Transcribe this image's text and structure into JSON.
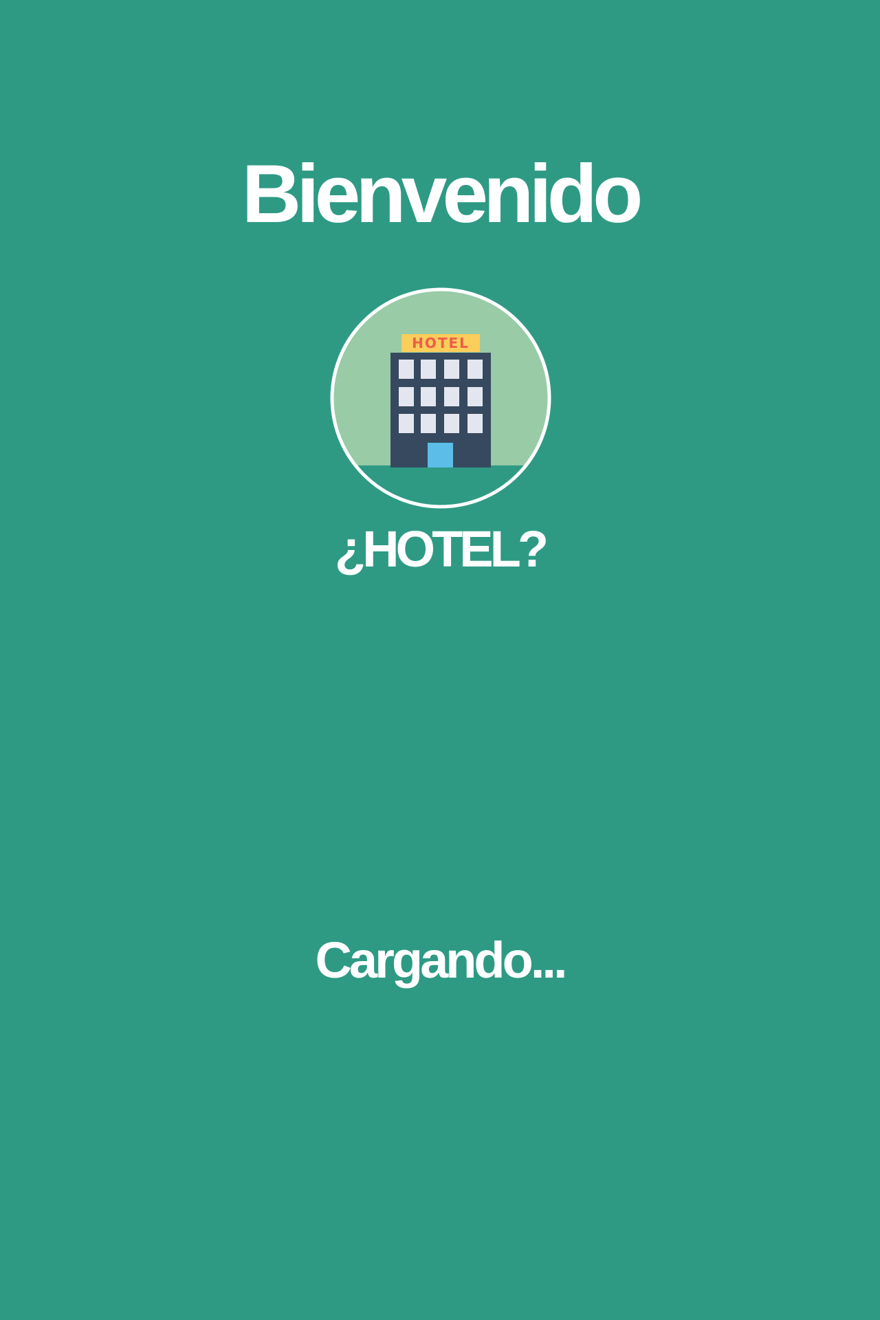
{
  "splash": {
    "title": "Bienvenido",
    "app_name": "¿HOTEL?",
    "loading_text": "Cargando...",
    "logo": {
      "icon": "hotel-building-icon",
      "sign_text": "HOTEL"
    }
  },
  "colors": {
    "background": "#2e9a84",
    "logo_circle": "#98cba6",
    "logo_ring": "#ffffff",
    "ground": "#2e9a84",
    "building": "#36495e",
    "windows": "#e4e6ef",
    "door": "#5bbde8",
    "sign_bg": "#fbcd5a",
    "sign_text": "#ec5e4a",
    "text": "#ffffff"
  }
}
